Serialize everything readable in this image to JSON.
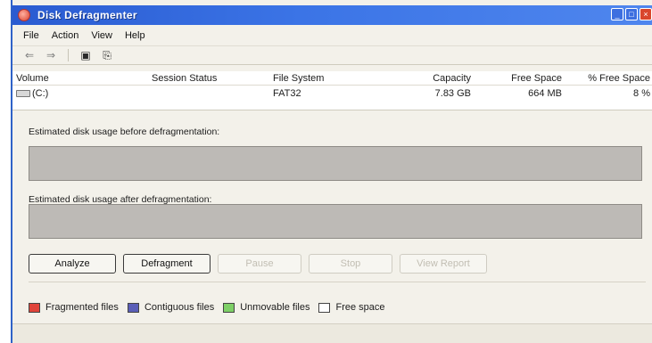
{
  "window": {
    "title": "Disk Defragmenter"
  },
  "menu": [
    "File",
    "Action",
    "View",
    "Help"
  ],
  "toolbar": {
    "buttons": [
      {
        "icon": "back-arrow-icon",
        "glyph": "⇐"
      },
      {
        "icon": "forward-arrow-icon",
        "glyph": "⇒"
      },
      {
        "icon": "properties-icon",
        "glyph": "▣"
      },
      {
        "icon": "help-icon",
        "glyph": "⎘"
      }
    ]
  },
  "volumes": {
    "columns": [
      "Volume",
      "Session Status",
      "File System",
      "Capacity",
      "Free Space",
      "% Free Space"
    ],
    "rows": [
      {
        "volume": "(C:)",
        "session_status": "",
        "file_system": "FAT32",
        "capacity": "7.83 GB",
        "free_space": "664 MB",
        "pct_free": "8 %"
      }
    ]
  },
  "analysis": {
    "before_label": "Estimated disk usage before defragmentation:",
    "after_label": "Estimated disk usage after defragmentation:"
  },
  "buttons": {
    "analyze": "Analyze",
    "defragment": "Defragment",
    "pause": "Pause",
    "stop": "Stop",
    "view_report": "View Report"
  },
  "legend": [
    {
      "label": "Fragmented files",
      "color": "#e0443a"
    },
    {
      "label": "Contiguous files",
      "color": "#5b5fb8"
    },
    {
      "label": "Unmovable files",
      "color": "#7ed067"
    },
    {
      "label": "Free space",
      "color": "#ffffff"
    }
  ],
  "colors": {
    "title_bar": "#2a5bd1",
    "usage_bar": "#bdbab6"
  }
}
